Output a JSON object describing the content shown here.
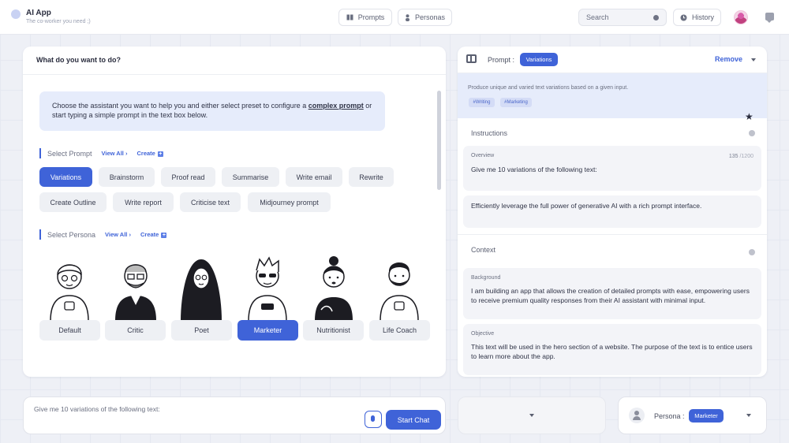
{
  "header": {
    "app_title": "AI App",
    "app_subtitle": "The co-worker you need ;)",
    "prompts_label": "Prompts",
    "personas_label": "Personas",
    "search_placeholder": "Search",
    "history_label": "History"
  },
  "left": {
    "question": "What do you want to do?",
    "info_text_1": "Choose the assistant you want to help you and either select preset to configure a ",
    "info_link": "complex prompt",
    "info_text_2": " or start typing a simple prompt in the text box below.",
    "select_prompt_label": "Select Prompt",
    "view_all_label": "View All",
    "create_label": "Create",
    "prompts": [
      "Variations",
      "Brainstorm",
      "Proof read",
      "Summarise",
      "Write email",
      "Rewrite",
      "Create Outline",
      "Write report",
      "Criticise text",
      "Midjourney prompt"
    ],
    "active_prompt": "Variations",
    "select_persona_label": "Select Persona",
    "personas": [
      "Default",
      "Critic",
      "Poet",
      "Marketer",
      "Nutritionist",
      "Life Coach"
    ],
    "active_persona": "Marketer"
  },
  "right": {
    "prompt_label": "Prompt :",
    "prompt_badge": "Variations",
    "remove_label": "Remove",
    "description": "Produce unique and varied text variations based on a given input.",
    "tags": [
      "#Writing",
      "#Marketing"
    ],
    "instructions_label": "Instructions",
    "overview_label": "Overview",
    "counter_value": "135",
    "counter_max": "/1200",
    "overview_text": "Give me 10 variations of the following text:",
    "second_text": "Efficiently leverage the full power of generative AI with a rich prompt interface.",
    "context_label": "Context",
    "background_label": "Background",
    "background_text": "I am building an app that allows the creation of detailed prompts with ease, empowering users to receive premium quality responses from their AI assistant with minimal input.",
    "objective_label": "Objective",
    "objective_text": "This text will be used in the hero section of a website. The purpose of the text is to entice users to learn more about the app."
  },
  "bottom": {
    "chat_text": "Give me 10 variations of the following text:",
    "start_chat_label": "Start Chat",
    "persona_label": "Persona :",
    "persona_badge": "Marketer"
  },
  "colors": {
    "accent": "#3f63d8",
    "accent_light": "#e6ecfb",
    "chip_bg": "#eef0f4"
  }
}
